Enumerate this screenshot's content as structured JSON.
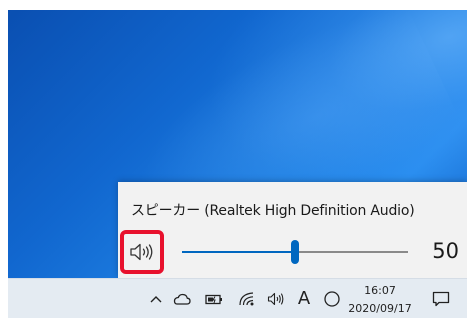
{
  "volume_flyout": {
    "device_name": "スピーカー (Realtek High Definition Audio)",
    "volume_value": "50",
    "volume_level": 50,
    "accent_color": "#0067c0",
    "highlight_color": "#e8112d",
    "speaker_icon": "speaker-icon"
  },
  "taskbar": {
    "tray_icons": [
      "chevron-up-icon",
      "onedrive-cloud-icon",
      "battery-charging-icon",
      "wifi-icon",
      "speaker-icon",
      "ime-mode-icon",
      "night-light-icon"
    ],
    "ime_label": "A",
    "clock": {
      "time": "16:07",
      "date": "2020/09/17"
    },
    "notification_icon": "notification-center-icon"
  }
}
